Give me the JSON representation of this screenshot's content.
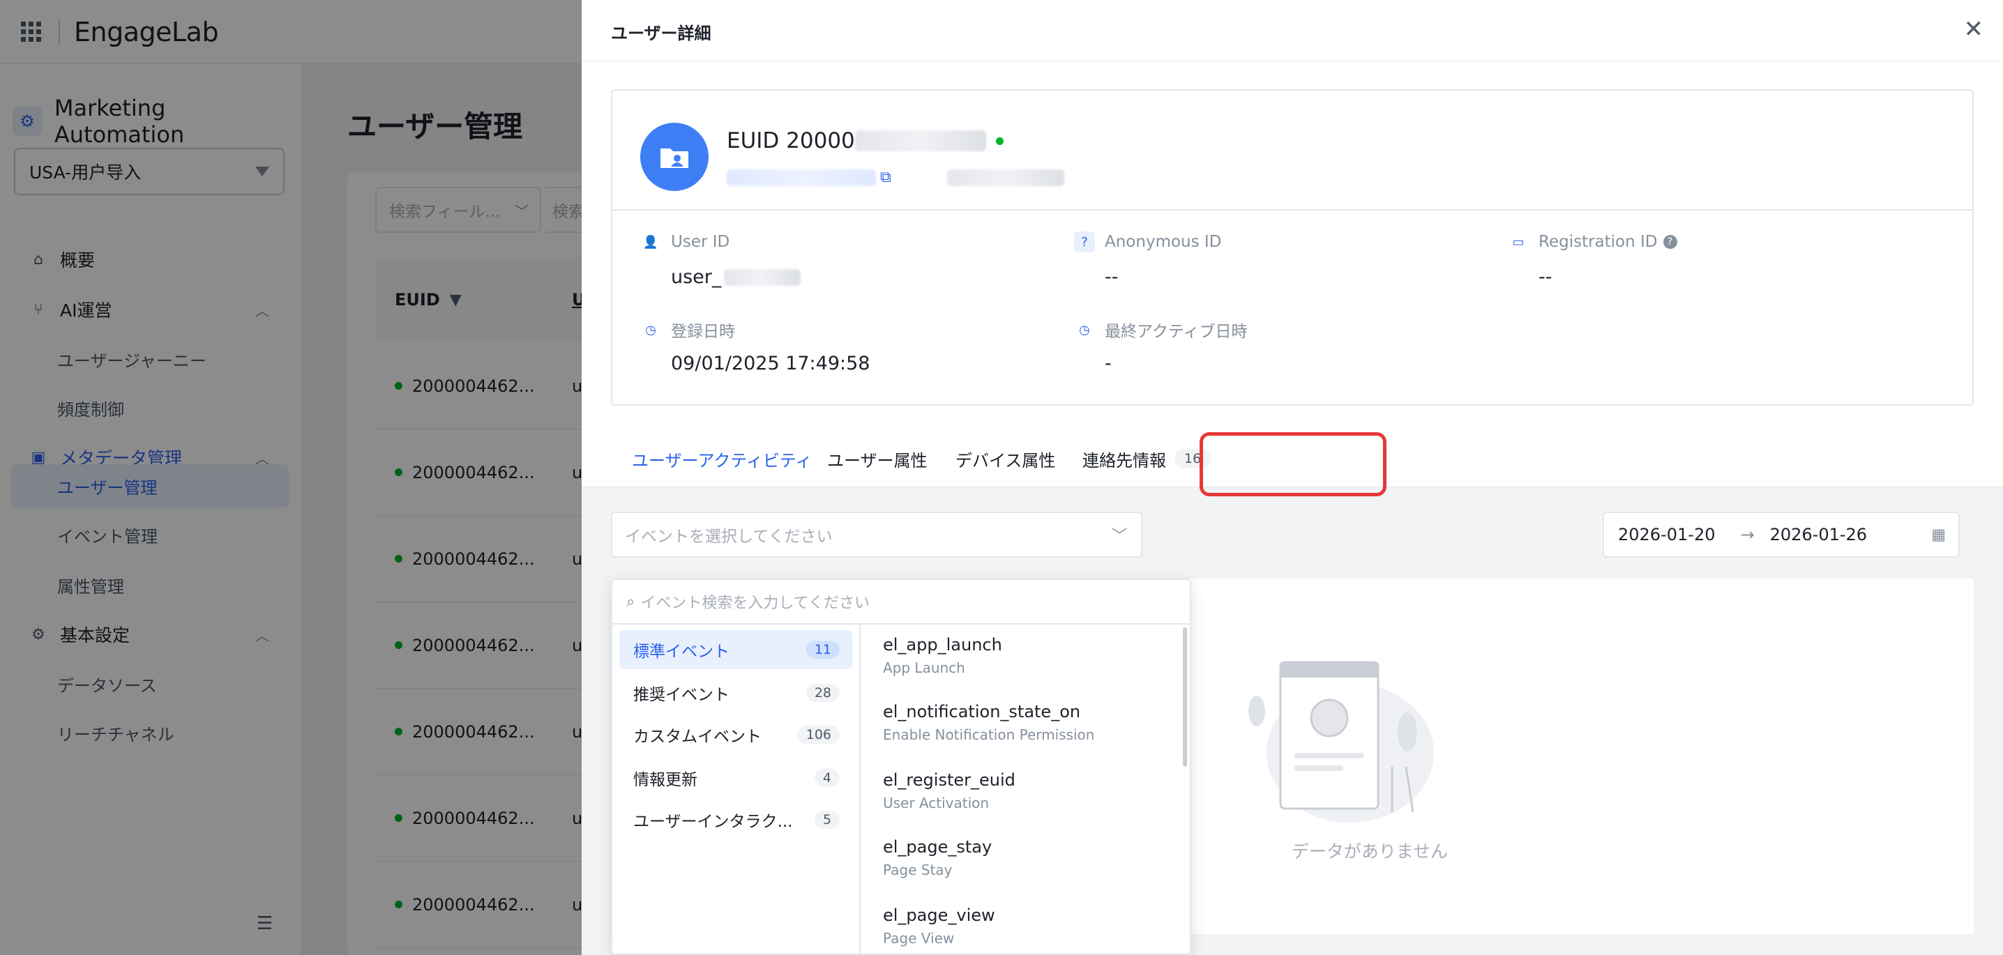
{
  "app": {
    "brand": "EngageLab",
    "product": "Marketing Automation",
    "project": "USA-用户导入"
  },
  "sidebar": {
    "groups": [
      {
        "label": "概要",
        "icon": "home-icon"
      },
      {
        "label": "AI運営",
        "icon": "flow-icon",
        "items": [
          "ユーザージャーニー",
          "頻度制御"
        ]
      },
      {
        "label": "メタデータ管理",
        "icon": "monitor-icon",
        "items": [
          "ユーザー管理",
          "イベント管理",
          "属性管理"
        ],
        "active_item": "ユーザー管理"
      },
      {
        "label": "基本設定",
        "icon": "settings-icon",
        "items": [
          "データソース",
          "リーチチャネル"
        ]
      }
    ]
  },
  "main": {
    "title": "ユーザー管理",
    "filter_placeholder": "検索フィール...",
    "search_placeholder": "検索",
    "column_header": "EUID",
    "next_column_header": "U",
    "rows": [
      "2000004462...",
      "2000004462...",
      "2000004462...",
      "2000004462...",
      "2000004462...",
      "2000004462...",
      "2000004462..."
    ],
    "row_next": "u"
  },
  "drawer": {
    "title": "ユーザー詳細",
    "euid_label": "EUID 20000",
    "fields": {
      "user_id_label": "User ID",
      "user_id_value": "user_",
      "anonymous_id_label": "Anonymous ID",
      "anonymous_id_value": "--",
      "registration_id_label": "Registration ID",
      "registration_id_value": "--",
      "registered_label": "登録日時",
      "registered_value": "09/01/2025 17:49:58",
      "last_active_label": "最終アクティブ日時",
      "last_active_value": "-"
    },
    "tabs": [
      {
        "label": "ユーザーアクティビティ"
      },
      {
        "label": "ユーザー属性"
      },
      {
        "label": "デバイス属性"
      },
      {
        "label": "連絡先情報",
        "badge": "16"
      }
    ],
    "event_select_placeholder": "イベントを選択してください",
    "date_start": "2026-01-20",
    "date_arrow": "→",
    "date_end": "2026-01-26",
    "empty_text": "データがありません"
  },
  "dropdown": {
    "search_placeholder": "イベント検索を入力してください",
    "categories": [
      {
        "label": "標準イベント",
        "count": "11"
      },
      {
        "label": "推奨イベント",
        "count": "28"
      },
      {
        "label": "カスタムイベント",
        "count": "106"
      },
      {
        "label": "情報更新",
        "count": "4"
      },
      {
        "label": "ユーザーインタラク...",
        "count": "5"
      }
    ],
    "events": [
      {
        "name": "el_app_launch",
        "desc": "App Launch"
      },
      {
        "name": "el_notification_state_on",
        "desc": "Enable Notification Permission"
      },
      {
        "name": "el_register_euid",
        "desc": "User Activation"
      },
      {
        "name": "el_page_stay",
        "desc": "Page Stay"
      },
      {
        "name": "el_page_view",
        "desc": "Page View"
      }
    ]
  },
  "colors": {
    "accent": "#2a62e9",
    "highlight": "#e53935",
    "online": "#00b42a"
  }
}
